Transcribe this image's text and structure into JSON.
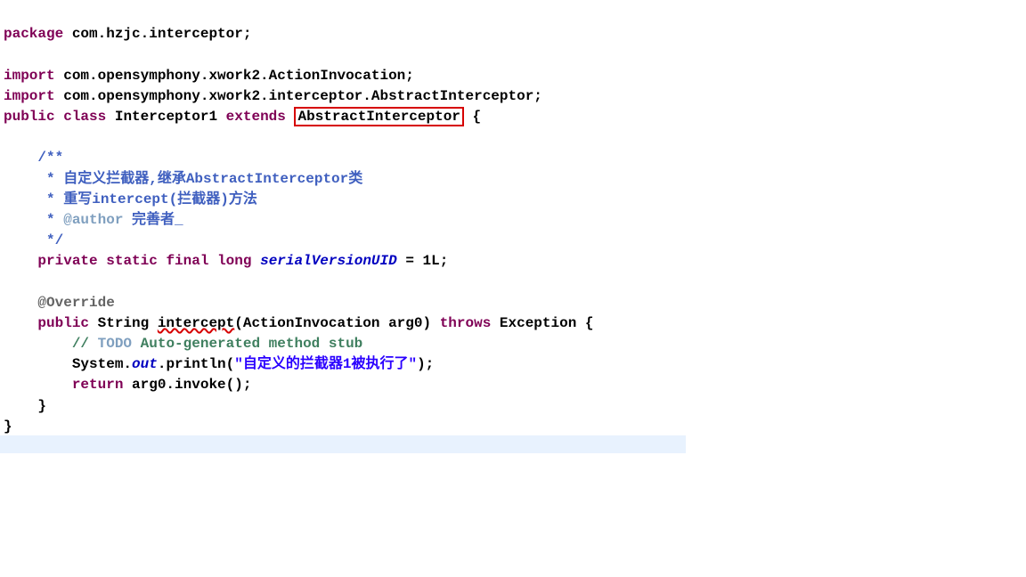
{
  "pkg_kw": "package",
  "pkg_name": " com.hzjc.interceptor;",
  "import_kw": "import",
  "import1": " com.opensymphony.xwork2.ActionInvocation;",
  "import2": " com.opensymphony.xwork2.interceptor.AbstractInterceptor;",
  "public_kw": "public",
  "class_kw": "class",
  "class_name": " Interceptor1 ",
  "extends_kw": "extends",
  "boxed_type": "AbstractInterceptor",
  "open_brace": " {",
  "jdoc_open": "    /**",
  "jdoc_l1": "     * 自定义拦截器,继承AbstractInterceptor类",
  "jdoc_l2": "     * 重写intercept(拦截器)方法",
  "jdoc_l3_pre": "     * ",
  "jdoc_author_tag": "@author",
  "jdoc_author_val": " 完善者_",
  "jdoc_close": "     */",
  "private_kw": "private",
  "static_kw": "static",
  "final_kw": "final",
  "long_kw": "long",
  "serial_field": "serialVersionUID",
  "serial_rest": " = 1L;",
  "override": "@Override",
  "string_type": " String ",
  "method_name": "intercept",
  "method_params": "(ActionInvocation arg0) ",
  "throws_kw": "throws",
  "exception_rest": " Exception {",
  "todo_pre": "        // ",
  "todo_kw": "TODO",
  "todo_rest": " Auto-generated method stub",
  "sysout_pre": "        System.",
  "out_field": "out",
  "println_pre": ".println(",
  "println_str": "\"自定义的拦截器1被执行了\"",
  "println_post": ");",
  "return_kw": "return",
  "return_rest": " arg0.invoke();",
  "close_method": "    }",
  "close_class": "}"
}
